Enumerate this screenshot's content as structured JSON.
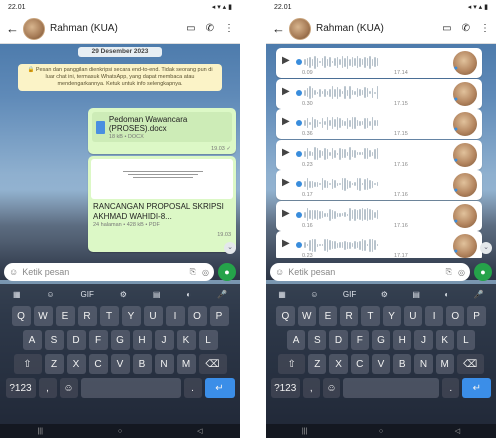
{
  "left": {
    "status": {
      "time": "22.01",
      "icons": "◂ ▾ ▴ ▮"
    },
    "header": {
      "back": "←",
      "contact": "Rahman (KUA)",
      "video_icon": "▭",
      "call_icon": "✆",
      "menu_icon": "⋮"
    },
    "date_chip": "29 Desember 2023",
    "notice": "🔒 Pesan dan panggilan dienkripsi secara end-to-end. Tidak seorang pun di luar chat ini, termasuk WhatsApp, yang dapat membaca atau mendengarkannya. Ketuk untuk info selengkapnya.",
    "doc1": {
      "title": "Pedoman Wawancara (PROSES).docx",
      "meta": "18 kB • DOCX",
      "time": "19.03 ✓"
    },
    "doc2": {
      "title": "RANCANGAN PROPOSAL SKRIPSI AKHMAD WAHIDI-8...",
      "meta": "24 halaman • 428 kB • PDF",
      "time": "19.03"
    },
    "composer": {
      "placeholder": "Ketik pesan"
    },
    "keyboard": {
      "toolbar": [
        "▦",
        "☺",
        "GIF",
        "⚙",
        "▤",
        "◐",
        "🎤"
      ],
      "row1": [
        "Q",
        "W",
        "E",
        "R",
        "T",
        "Y",
        "U",
        "I",
        "O",
        "P"
      ],
      "row2": [
        "A",
        "S",
        "D",
        "F",
        "G",
        "H",
        "J",
        "K",
        "L"
      ],
      "row3": [
        "⇧",
        "Z",
        "X",
        "C",
        "V",
        "B",
        "N",
        "M",
        "⌫"
      ],
      "row4": [
        "?123",
        ",",
        "☺",
        "",
        ".",
        "↵"
      ]
    },
    "nav": [
      "|||",
      "○",
      "◁"
    ]
  },
  "right": {
    "status": {
      "time": "22.01",
      "icons": "◂ ▾ ▴ ▮"
    },
    "header": {
      "back": "←",
      "contact": "Rahman (KUA)",
      "video_icon": "▭",
      "call_icon": "✆",
      "menu_icon": "⋮"
    },
    "voice_notes": [
      {
        "dur": "0.09",
        "time": "17.14"
      },
      {
        "dur": "0.30",
        "time": "17.15"
      },
      {
        "dur": "0.36",
        "time": "17.15"
      },
      {
        "dur": "0.23",
        "time": "17.16"
      },
      {
        "dur": "0.17",
        "time": "17.16"
      },
      {
        "dur": "0.16",
        "time": "17.16"
      },
      {
        "dur": "0.23",
        "time": "17.17"
      }
    ],
    "composer": {
      "placeholder": "Ketik pesan"
    },
    "keyboard": {
      "toolbar": [
        "▦",
        "☺",
        "GIF",
        "⚙",
        "▤",
        "◐",
        "🎤"
      ],
      "row1": [
        "Q",
        "W",
        "E",
        "R",
        "T",
        "Y",
        "U",
        "I",
        "O",
        "P"
      ],
      "row2": [
        "A",
        "S",
        "D",
        "F",
        "G",
        "H",
        "J",
        "K",
        "L"
      ],
      "row3": [
        "⇧",
        "Z",
        "X",
        "C",
        "V",
        "B",
        "N",
        "M",
        "⌫"
      ],
      "row4": [
        "?123",
        ",",
        "☺",
        "",
        ".",
        "↵"
      ]
    },
    "nav": [
      "|||",
      "○",
      "◁"
    ]
  }
}
